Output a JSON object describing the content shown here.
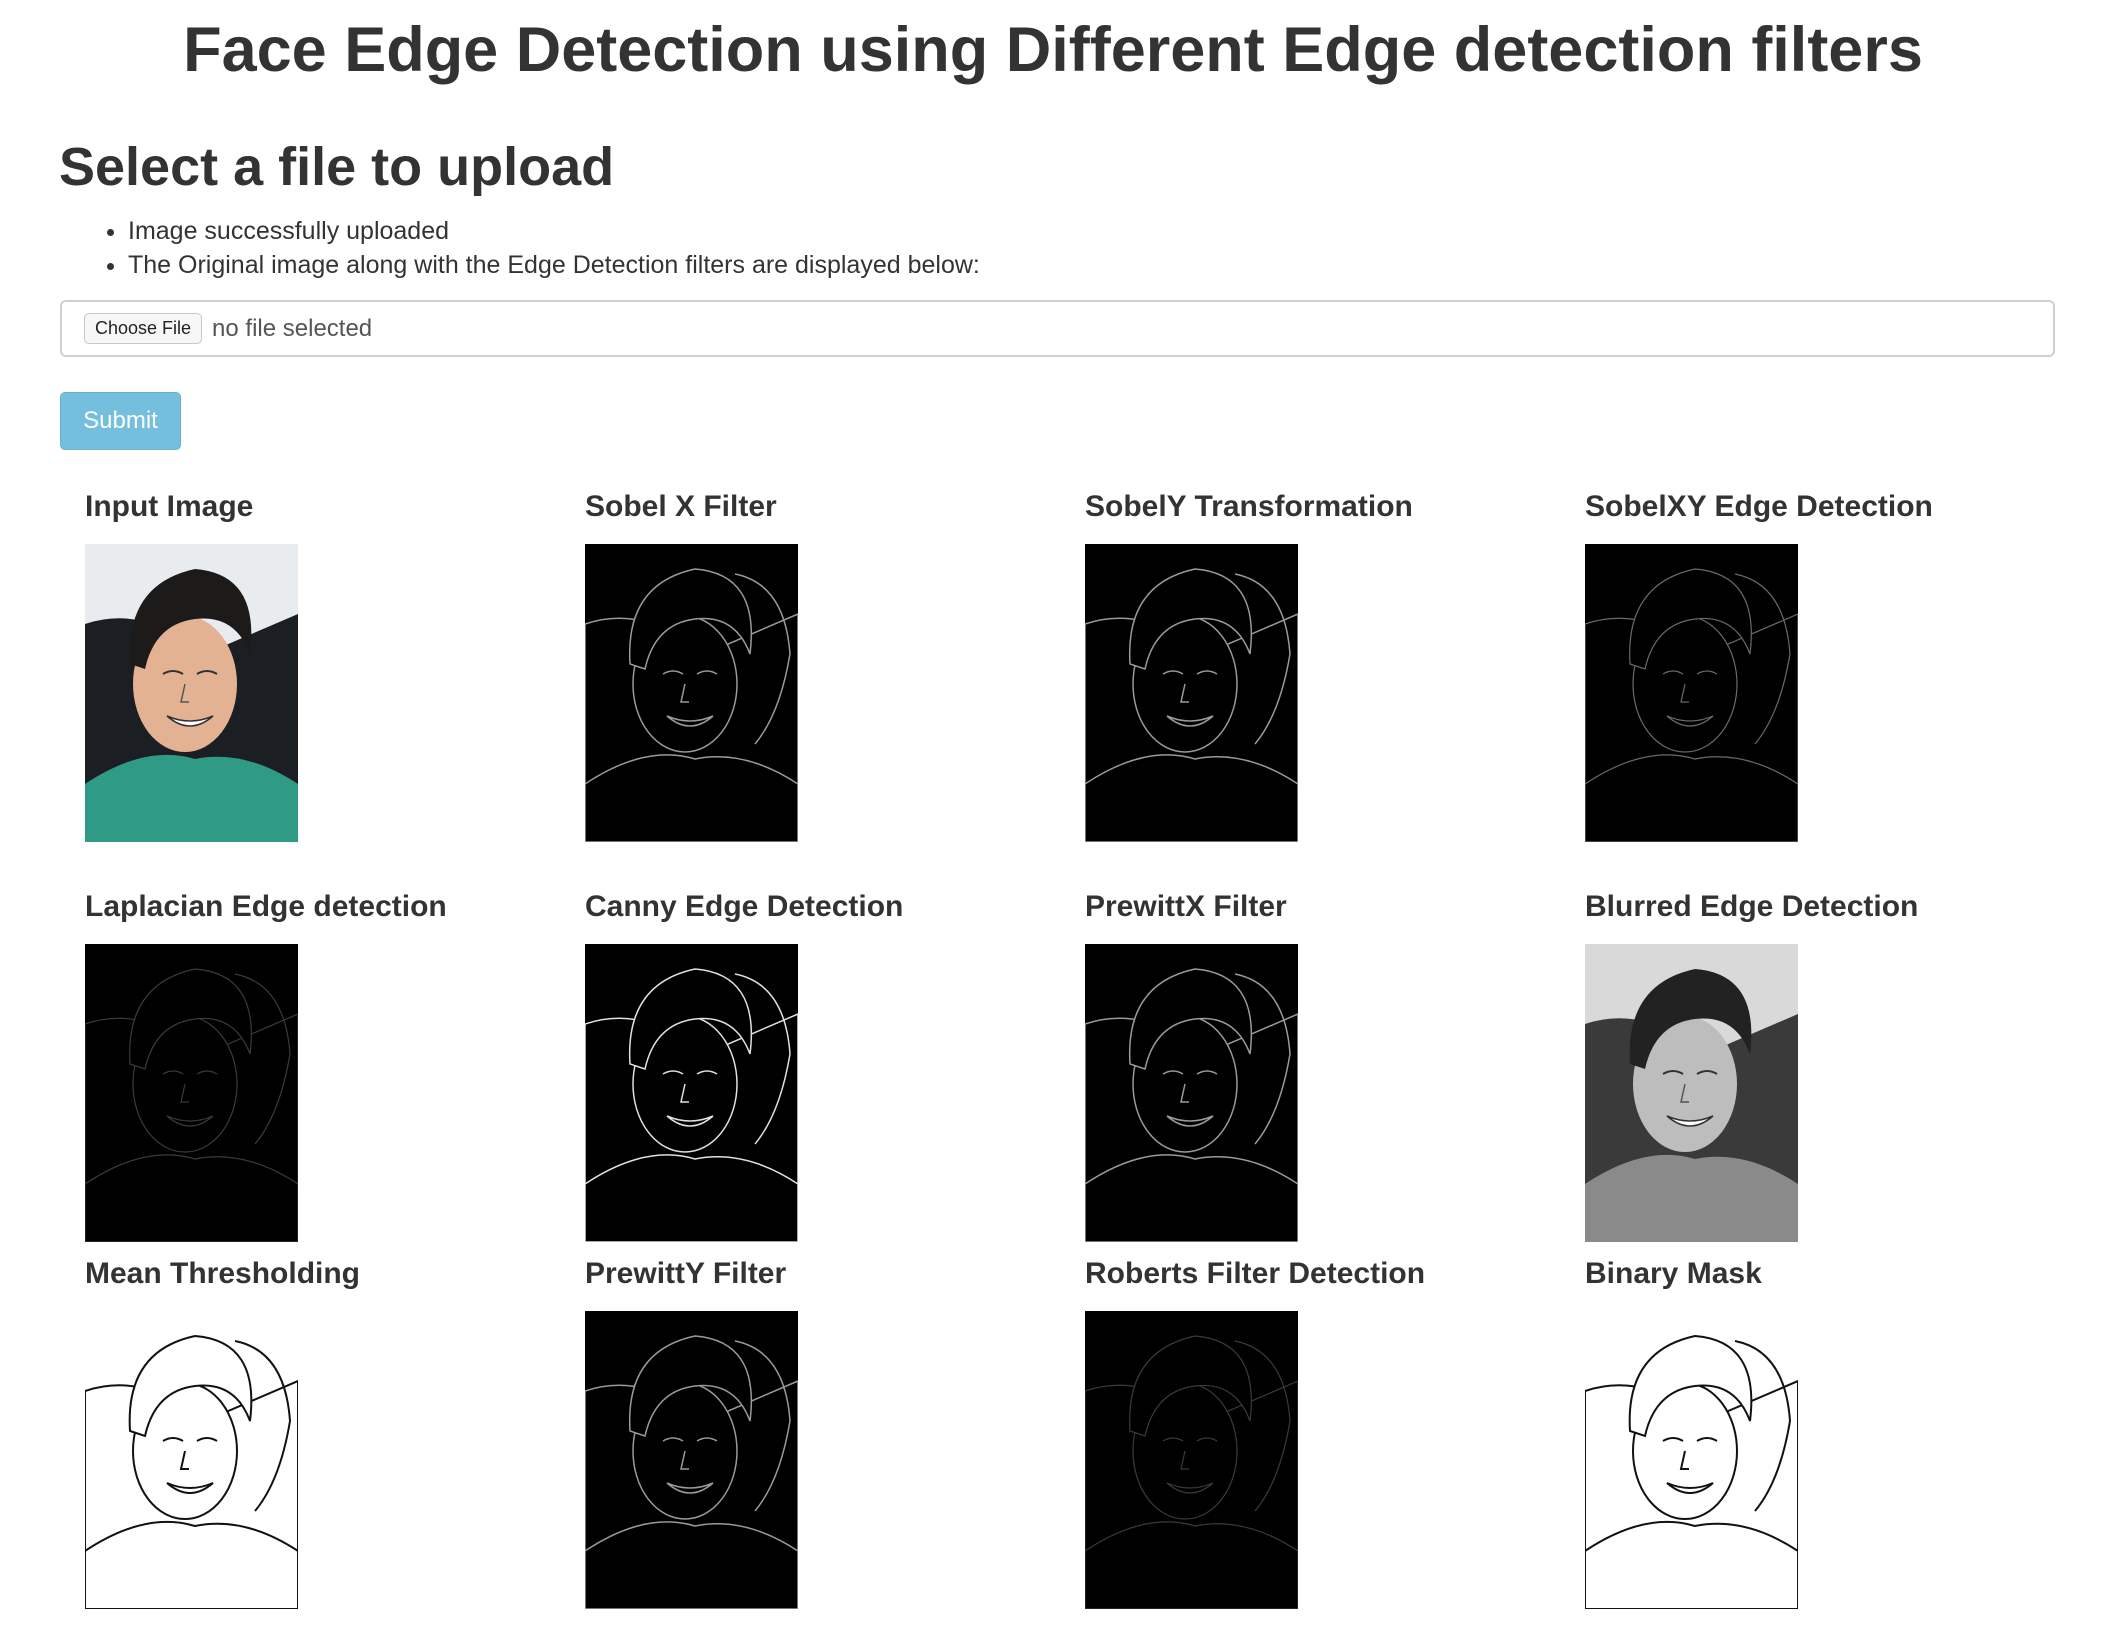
{
  "page": {
    "title": "Face Edge Detection using Different Edge detection filters"
  },
  "upload": {
    "heading": "Select a file to upload",
    "messages": [
      "Image successfully uploaded",
      "The Original image along with the Edge Detection filters are displayed below:"
    ],
    "choose_file_label": "Choose File",
    "file_status": "no file selected",
    "submit_label": "Submit"
  },
  "results": [
    {
      "title": "Input Image",
      "style": "color"
    },
    {
      "title": "Sobel X Filter",
      "style": "edge"
    },
    {
      "title": "SobelY Transformation",
      "style": "edge"
    },
    {
      "title": "SobelXY Edge Detection",
      "style": "edge-dim"
    },
    {
      "title": "Laplacian Edge detection",
      "style": "edge-faint"
    },
    {
      "title": "Canny Edge Detection",
      "style": "edge-bright"
    },
    {
      "title": "PrewittX Filter",
      "style": "edge"
    },
    {
      "title": "Blurred Edge Detection",
      "style": "gray"
    },
    {
      "title": "Mean Thresholding",
      "style": "sketch"
    },
    {
      "title": "PrewittY Filter",
      "style": "edge"
    },
    {
      "title": "Roberts Filter Detection",
      "style": "edge-faint"
    },
    {
      "title": "Binary Mask",
      "style": "sketch"
    }
  ],
  "colors": {
    "text": "#333333",
    "submit_bg": "#74bfdd",
    "input_border": "#cfcfcf"
  }
}
